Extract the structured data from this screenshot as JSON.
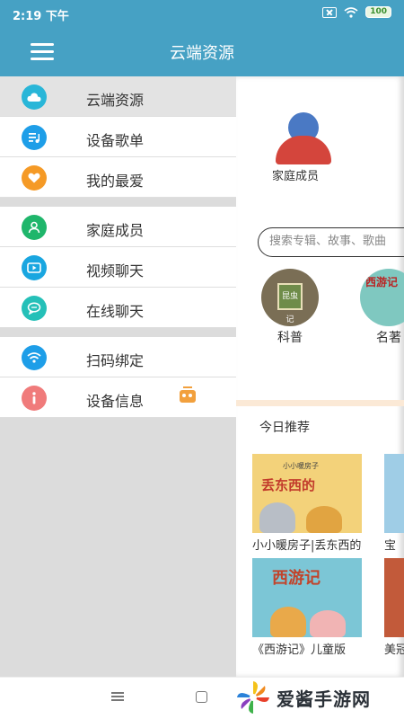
{
  "status": {
    "time": "2:19 下午",
    "battery": "100"
  },
  "header": {
    "title": "云端资源"
  },
  "drawer": {
    "groups": [
      [
        {
          "label": "云端资源",
          "icon": "cloud-icon",
          "color": "#29b6d8",
          "active": true
        },
        {
          "label": "设备歌单",
          "icon": "playlist-icon",
          "color": "#1e9ee8"
        },
        {
          "label": "我的最爱",
          "icon": "heart-icon",
          "color": "#f59a26"
        }
      ],
      [
        {
          "label": "家庭成员",
          "icon": "person-icon",
          "color": "#1fb66b"
        },
        {
          "label": "视频聊天",
          "icon": "video-icon",
          "color": "#19a6e0"
        },
        {
          "label": "在线聊天",
          "icon": "chat-icon",
          "color": "#25c0b8"
        }
      ],
      [
        {
          "label": "扫码绑定",
          "icon": "wifi-icon",
          "color": "#1e9ee8"
        },
        {
          "label": "设备信息",
          "icon": "info-icon",
          "color": "#f07b7b"
        }
      ]
    ]
  },
  "content": {
    "member_label": "家庭成员",
    "search_placeholder": "搜索专辑、故事、歌曲",
    "categories": [
      {
        "label": "科普",
        "thumb_text": "昆虫记"
      },
      {
        "label": "名著",
        "thumb_text": "西游记"
      }
    ],
    "section_title": "今日推荐",
    "cards": [
      {
        "caption": "小小暖房子|丢东西的小动物系列",
        "thumb_sub": "小小暖房子",
        "thumb_title": "丢东西的"
      },
      {
        "caption": "宝"
      },
      {
        "caption": "《西游记》儿童版",
        "thumb_title": "西游记"
      },
      {
        "caption": "美冠"
      }
    ]
  },
  "watermark": {
    "text": "爱酱手游网"
  },
  "colors": {
    "primary": "#46a1c4",
    "drawer_bg": "#dcdcdc"
  }
}
